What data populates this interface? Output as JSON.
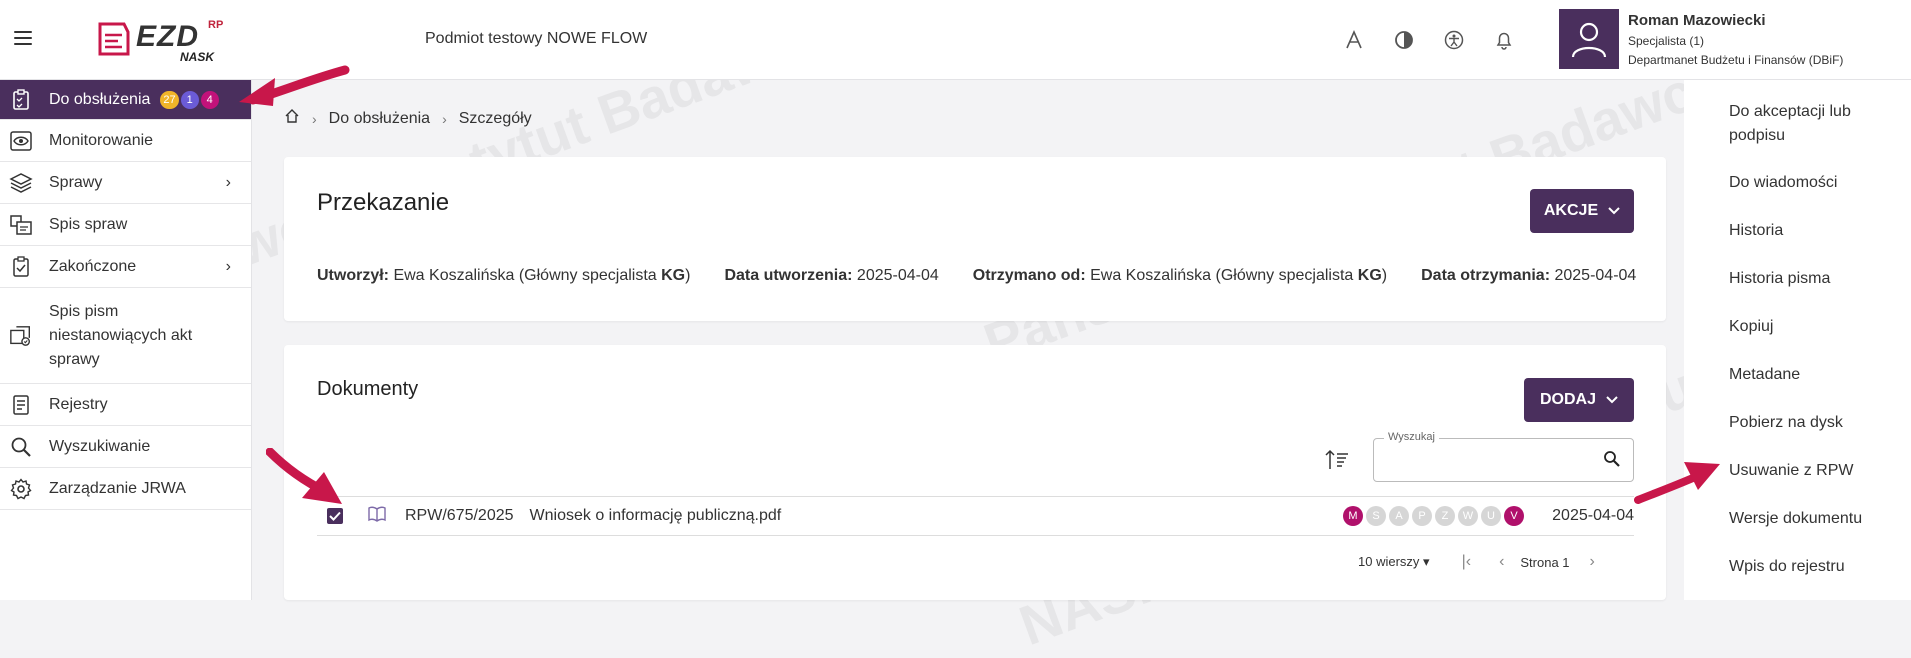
{
  "topbar": {
    "org_name": "Podmiot testowy NOWE FLOW",
    "logo": {
      "text": "EZD",
      "rp": "RP",
      "nask": "NASK"
    },
    "icons": [
      "font-size-icon",
      "contrast-icon",
      "accessibility-icon",
      "notifications-icon"
    ],
    "user": {
      "name": "Roman Mazowiecki",
      "role": "Specjalista (1)",
      "department": "Departmanet Budżetu i Finansów (DBiF)"
    }
  },
  "sidebar": {
    "items": [
      {
        "label": "Do obsłużenia",
        "icon": "clipboard-check-icon",
        "active": true,
        "badges": [
          "27",
          "1",
          "4"
        ]
      },
      {
        "label": "Monitorowanie",
        "icon": "eye-icon"
      },
      {
        "label": "Sprawy",
        "icon": "layers-icon",
        "chevron": true
      },
      {
        "label": "Spis spraw",
        "icon": "files-icon"
      },
      {
        "label": "Zakończone",
        "icon": "clipboard-done-icon",
        "chevron": true
      },
      {
        "label_lines": [
          "Spis pism",
          "niestanowiących akt",
          "sprawy"
        ],
        "icon": "documents-icon"
      },
      {
        "label": "Rejestry",
        "icon": "register-icon"
      },
      {
        "label": "Wyszukiwanie",
        "icon": "search-icon"
      },
      {
        "label": "Zarządzanie JRWA",
        "icon": "gear-icon"
      }
    ]
  },
  "breadcrumb": [
    "Do obsłużenia",
    "Szczegóły"
  ],
  "przekazanie": {
    "title": "Przekazanie",
    "action_button": "AKCJE",
    "created_by_label": "Utworzył:",
    "created_by_value": "Ewa Koszalińska (Główny specjalista ",
    "created_by_code": "KG",
    "created_date_label": "Data utworzenia:",
    "created_date_value": "2025-04-04",
    "received_from_label": "Otrzymano od:",
    "received_from_value": "Ewa Koszalińska (Główny specjalista ",
    "received_from_code": "KG",
    "received_date_label": "Data otrzymania:",
    "received_date_value": "2025-04-04",
    "close_paren": ")"
  },
  "dokumenty": {
    "title": "Dokumenty",
    "add_button": "DODAJ",
    "search_label": "Wyszukaj",
    "row": {
      "number": "RPW/675/2025",
      "name": "Wniosek o informację publiczną.pdf",
      "status_letters": [
        "M",
        "S",
        "A",
        "P",
        "Z",
        "W",
        "U",
        "V"
      ],
      "date": "2025-04-04"
    },
    "pager": {
      "rows_per_page": "10 wierszy",
      "page": "Strona 1"
    }
  },
  "right_panel": {
    "items": [
      "Do akceptacji lub podpisu",
      "Do wiadomości",
      "Historia",
      "Historia pisma",
      "Kopiuj",
      "Metadane",
      "Pobierz na dysk",
      "Usuwanie z RPW",
      "Wersje dokumentu",
      "Wpis do rejestru"
    ]
  },
  "colors": {
    "primary": "#4a2f5d",
    "badge_yellow": "#f0b429",
    "badge_purple": "#6b5bd6",
    "badge_pink": "#c2127a",
    "arrow": "#c8174a",
    "status_active": "#b0106b",
    "status_inactive": "#d6d6d6"
  }
}
